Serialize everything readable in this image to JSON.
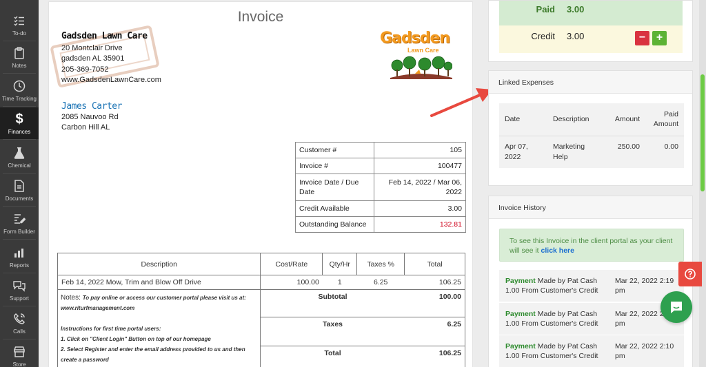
{
  "sidebar": {
    "items": [
      {
        "label": "To-do",
        "icon": "checklist-icon"
      },
      {
        "label": "Notes",
        "icon": "clipboard-icon"
      },
      {
        "label": "Time Tracking",
        "icon": "clock-icon"
      },
      {
        "label": "Finances",
        "icon": "dollar-icon",
        "active": true
      },
      {
        "label": "Chemical",
        "icon": "flask-icon"
      },
      {
        "label": "Documents",
        "icon": "document-icon"
      },
      {
        "label": "Form Builder",
        "icon": "form-edit-icon"
      },
      {
        "label": "Reports",
        "icon": "bar-chart-icon"
      },
      {
        "label": "Support",
        "icon": "chat-bubbles-icon"
      },
      {
        "label": "Calls",
        "icon": "phone-icon"
      },
      {
        "label": "Store",
        "icon": "store-icon"
      }
    ]
  },
  "invoice": {
    "title": "Invoice",
    "company": {
      "name": "Gadsden Lawn Care",
      "address1": "20 Montclair Drive",
      "address2": "gadsden AL 35901",
      "phone": "205-369-7052",
      "website": "www.GadsdenLawnCare.com",
      "logo_text": "Gadsden",
      "logo_sub": "Lawn Care"
    },
    "customer": {
      "name": "James Carter",
      "address1": "2085 Nauvoo Rd",
      "address2": "Carbon Hill AL"
    },
    "info": [
      {
        "label": "Customer #",
        "value": "105"
      },
      {
        "label": "Invoice #",
        "value": "100477"
      },
      {
        "label": "Invoice Date / Due Date",
        "value": "Feb 14, 2022 / Mar 06, 2022"
      },
      {
        "label": "Credit Available",
        "value": "3.00"
      },
      {
        "label": "Outstanding Balance",
        "value": "132.81"
      }
    ],
    "items_header": {
      "description": "Description",
      "cost_rate": "Cost/Rate",
      "qty_hr": "Qty/Hr",
      "taxes": "Taxes %",
      "total": "Total"
    },
    "items": [
      {
        "description": "Feb 14, 2022 Mow, Trim and Blow Off Drive",
        "cost_rate": "100.00",
        "qty_hr": "1",
        "taxes": "6.25",
        "total": "106.25"
      }
    ],
    "notes": {
      "label": "Notes:",
      "line1": "To pay online or access our customer portal please visit us at: www.riturfmanagement.com",
      "line2": "Instructions for first time portal users:",
      "line3": "1. Click on \"Client Login\" Button on top of our homepage",
      "line4": "2. Select Register and enter the email address provided to us and then create a password"
    },
    "summary": {
      "subtotal_label": "Subtotal",
      "subtotal_value": "100.00",
      "taxes_label": "Taxes",
      "taxes_value": "6.25",
      "total_label": "Total",
      "total_value": "106.25"
    }
  },
  "payment_summary": {
    "paid_label": "Paid",
    "paid_value": "3.00",
    "credit_label": "Credit",
    "credit_value": "3.00",
    "minus_label": "−",
    "plus_label": "+"
  },
  "linked_expenses": {
    "title": "Linked Expenses",
    "headers": {
      "date": "Date",
      "description": "Description",
      "amount": "Amount",
      "paid_amount": "Paid Amount"
    },
    "rows": [
      {
        "date": "Apr 07, 2022",
        "description": "Marketing Help",
        "amount": "250.00",
        "paid_amount": "0.00"
      }
    ]
  },
  "invoice_history": {
    "title": "Invoice History",
    "notice_text": "To see this Invoice in the client portal as your client will see it",
    "notice_link": "click here",
    "items": [
      {
        "type": "Payment",
        "text": "Made by Pat Cash 1.00 From Customer's Credit",
        "time": "Mar 22, 2022 2:19 pm"
      },
      {
        "type": "Payment",
        "text": "Made by Pat Cash 1.00 From Customer's Credit",
        "time": "Mar 22, 2022 2:19 pm"
      },
      {
        "type": "Payment",
        "text": "Made by Pat Cash 1.00 From Customer's Credit",
        "time": "Mar 22, 2022 2:10 pm"
      }
    ]
  },
  "colors": {
    "accent_green": "#5cb334",
    "danger_red": "#d9333f",
    "link_blue": "#1a73b5",
    "arrow_red": "#e8493f"
  }
}
